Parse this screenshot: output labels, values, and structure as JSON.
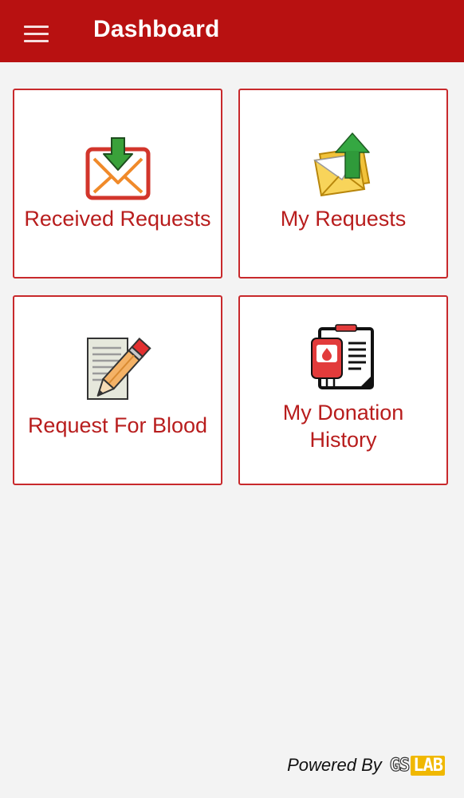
{
  "appbar": {
    "title": "Dashboard",
    "menu_icon": "hamburger-menu-icon",
    "color": "#b81111"
  },
  "tiles": [
    {
      "label": "Received Requests",
      "icon": "mail-inbox-download-icon"
    },
    {
      "label": "My Requests",
      "icon": "envelope-upload-icon"
    },
    {
      "label": "Request For Blood",
      "icon": "paper-pencil-icon"
    },
    {
      "label_line1": "My Donation",
      "label_line2": "History",
      "icon": "blood-bag-clipboard-icon"
    }
  ],
  "footer": {
    "powered_by": "Powered By",
    "logo_gs": "GS",
    "logo_lab": "LAB"
  },
  "colors": {
    "accent": "#b81d1d",
    "border": "#c8292c",
    "background": "#f3f3f3",
    "logo_yellow": "#f0b800"
  }
}
